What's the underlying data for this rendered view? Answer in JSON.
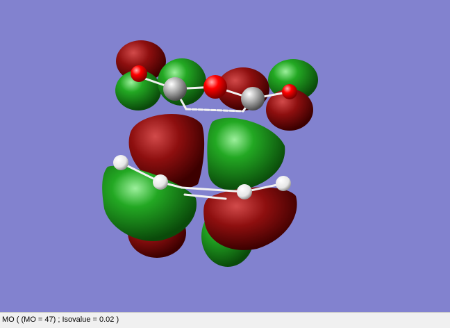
{
  "statusbar": {
    "text": "MO ( (MO = 47) ; Isovalue = 0.02 )"
  },
  "viewer": {
    "background_color": "#8282cf",
    "positive_lobe_color": "#8b0000",
    "negative_lobe_color": "#1a8c1a",
    "carbon_color": "#b0b0b0",
    "oxygen_color": "#ff0000",
    "hydrogen_color": "#ffffff"
  }
}
